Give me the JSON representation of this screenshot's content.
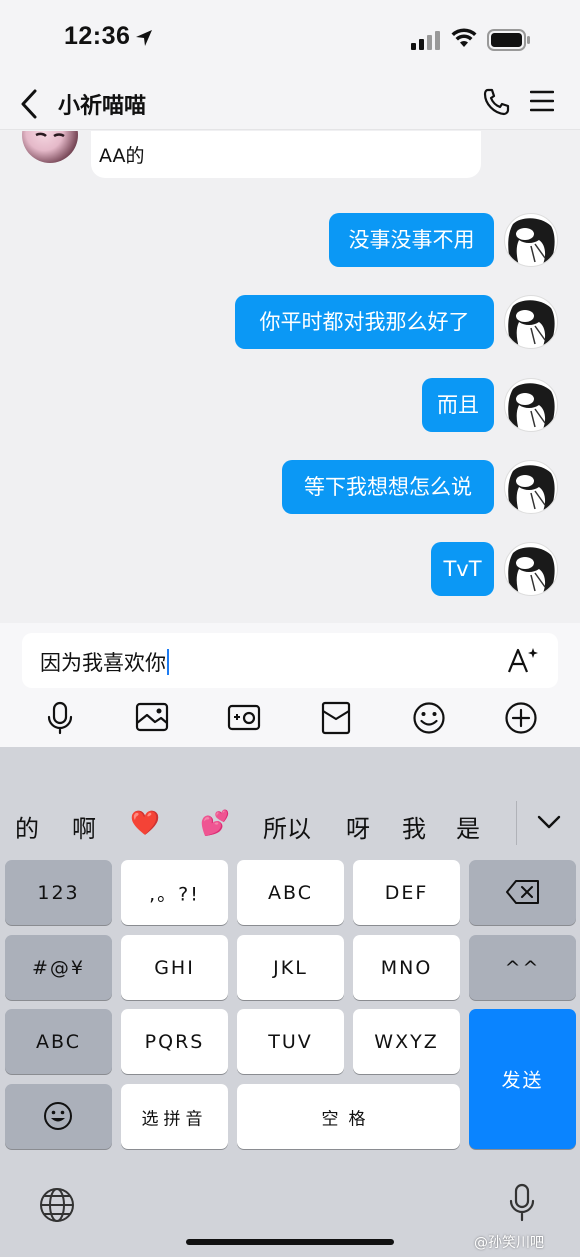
{
  "status_bar": {
    "time": "12:36"
  },
  "header": {
    "title": "小祈喵喵"
  },
  "chat": {
    "incoming_tail": "AA的",
    "outgoing": [
      "没事没事不用",
      "你平时都对我那么好了",
      "而且",
      "等下我想想怎么说",
      "TvT"
    ]
  },
  "input": {
    "value": "因为我喜欢你"
  },
  "candidates": [
    "的",
    "啊",
    "❤️",
    "💕",
    "所以",
    "呀",
    "我",
    "是"
  ],
  "keys": {
    "num": "123",
    "punct": ",。?!",
    "abc": "ABC",
    "def": "DEF",
    "symbols": "#@¥",
    "ghi": "GHI",
    "jkl": "JKL",
    "mno": "MNO",
    "face": "^^",
    "abc_switch": "ABC",
    "pqrs": "PQRS",
    "tuv": "TUV",
    "wxyz": "WXYZ",
    "send": "发送",
    "pinyin": "选拼音",
    "space": "空格"
  },
  "colors": {
    "accent": "#0b98f5",
    "send_key": "#0a84ff"
  },
  "watermark": "@孙笑川吧"
}
